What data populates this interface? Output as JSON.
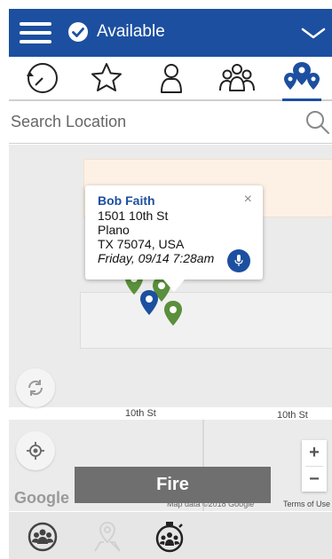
{
  "header": {
    "status": "Available",
    "menu_icon": "hamburger-icon",
    "status_icon": "check-circle-icon",
    "dropdown_icon": "chevron-down-icon",
    "color": "#1c4fa0"
  },
  "tabs": [
    {
      "icon": "history-icon"
    },
    {
      "icon": "star-icon"
    },
    {
      "icon": "person-icon"
    },
    {
      "icon": "group-icon"
    },
    {
      "icon": "locations-icon",
      "active": true
    }
  ],
  "search": {
    "placeholder": "Search Location"
  },
  "map": {
    "streets": [
      "10th St",
      "10th St"
    ],
    "popup": {
      "name": "Bob Faith",
      "address1": "1501 10th St",
      "city": "Plano",
      "state_zip": "TX 75074, USA",
      "time": "Friday, 09/14 7:28am",
      "close": "×"
    },
    "zoom_in": "+",
    "zoom_out": "−",
    "logo": "Google",
    "attribution": "Map data ©2018 Google",
    "terms": "Terms of Use",
    "pin_colors": {
      "green": "#5a8f3c",
      "blue": "#1c4fa0"
    }
  },
  "fire_button": "Fire",
  "bottom_bar": [
    {
      "icon": "group-circle-icon"
    },
    {
      "icon": "map-pin-icon"
    },
    {
      "icon": "stopwatch-group-icon"
    }
  ]
}
